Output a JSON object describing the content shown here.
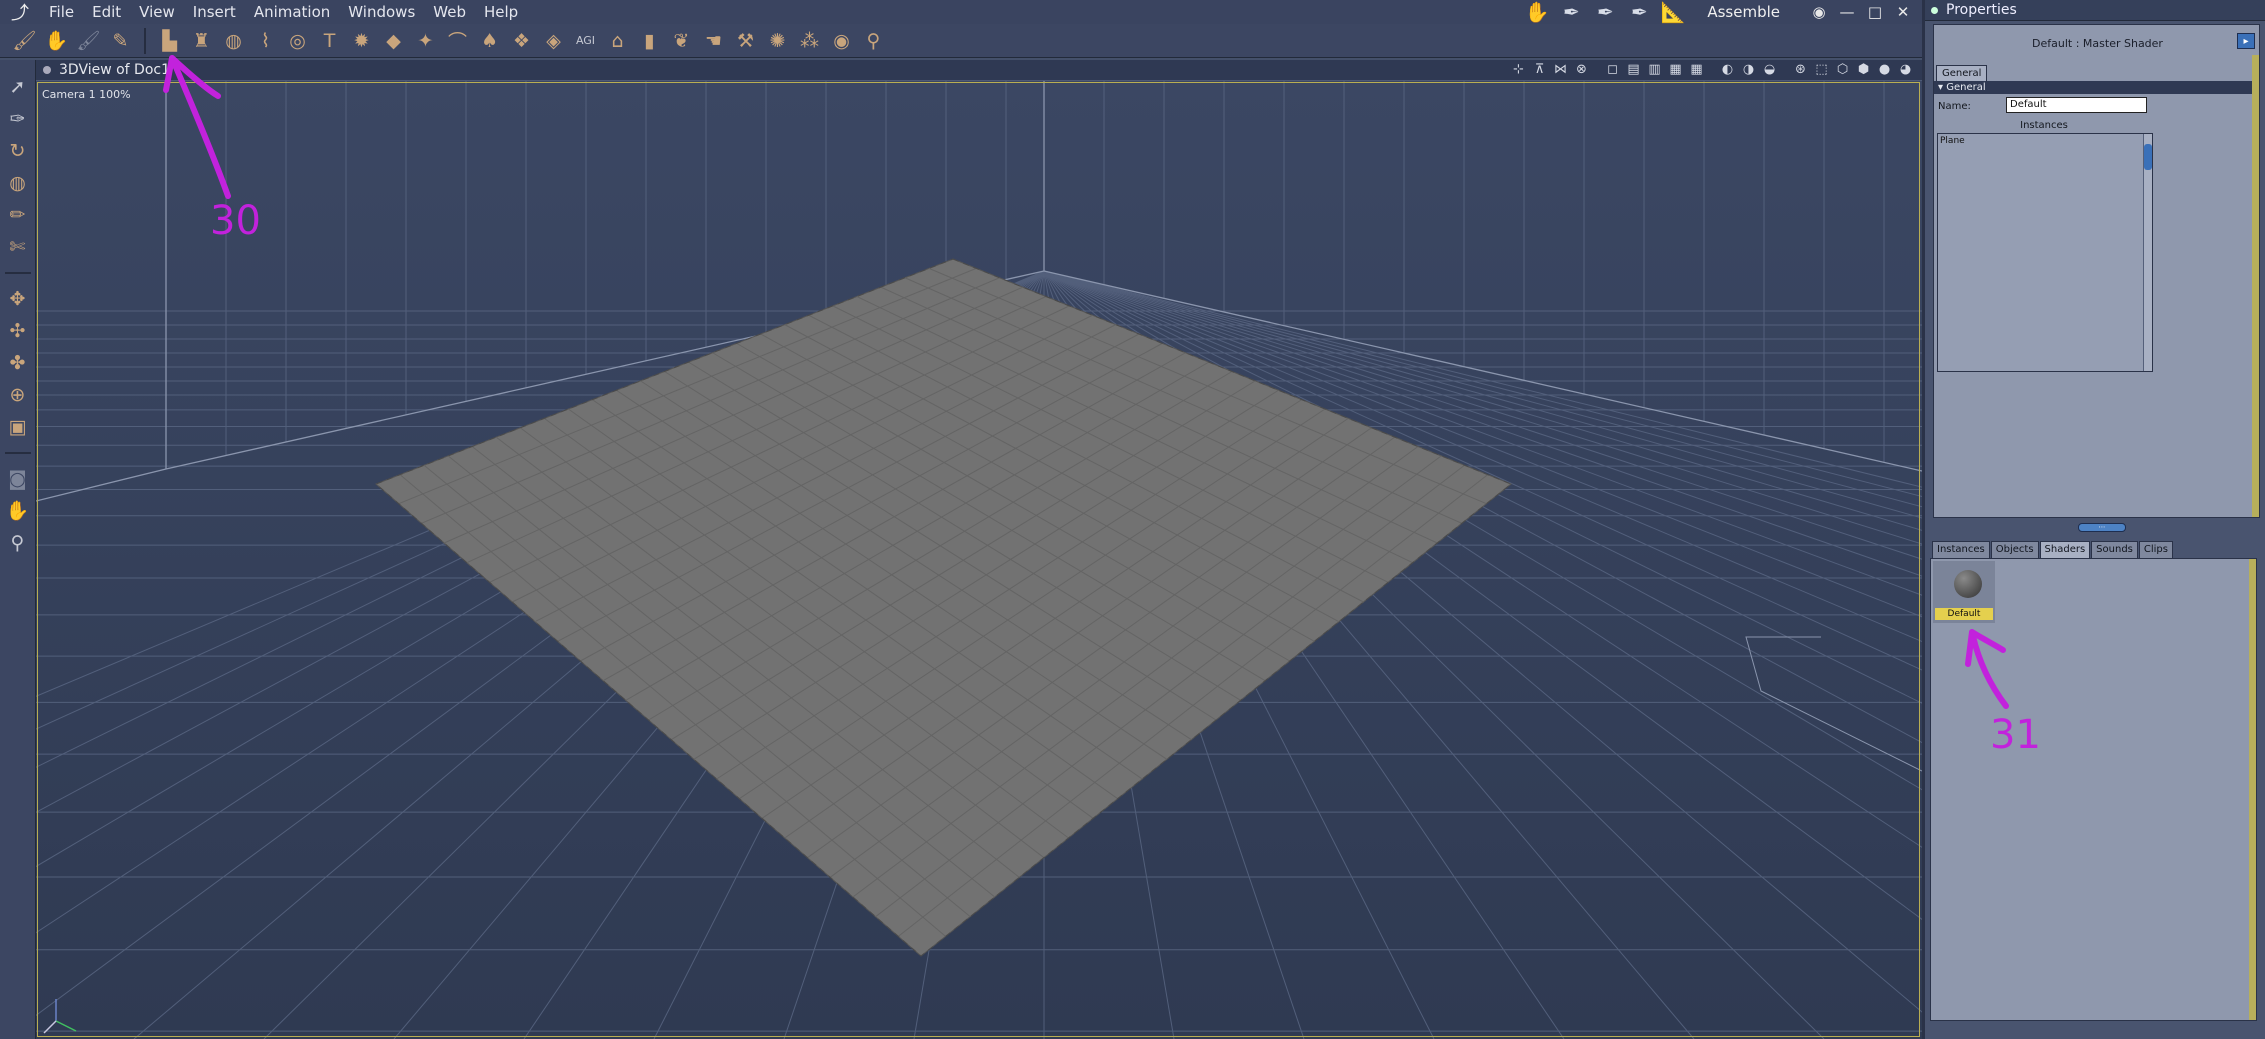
{
  "menubar": {
    "items": [
      "File",
      "Edit",
      "View",
      "Insert",
      "Animation",
      "Windows",
      "Web",
      "Help"
    ],
    "room": "Assemble",
    "room_icons": [
      "hand-icon",
      "pen-icon",
      "pen-icon",
      "pen-icon",
      "ruler-icon"
    ],
    "window_buttons": [
      "◉",
      "—",
      "□",
      "✕"
    ]
  },
  "toolbar": {
    "icons": [
      "paint-brush-icon",
      "hand-icon",
      "brush-icon",
      "sculpt-brush-icon",
      "terrain-icon",
      "lathe-icon",
      "sphere-icon",
      "pipe-icon",
      "torus-icon",
      "text-icon",
      "gear-icon",
      "plane-icon",
      "landscape-icon",
      "boolean-icon",
      "primitive-icon",
      "box-icon",
      "box-icon",
      "agi-icon",
      "house-icon",
      "cylinder-icon",
      "leaf-icon",
      "hand-shape-icon",
      "magic-wand-icon",
      "cog-icon",
      "tree-icon",
      "target-icon",
      "bone-icon"
    ]
  },
  "lefttools": {
    "group1": [
      "select-arrow-icon",
      "pen-tool-icon",
      "rotate-icon",
      "spiral-icon",
      "pencil-icon",
      "knife-icon"
    ],
    "group2": [
      "move-icon",
      "move-alt-icon",
      "scale-icon",
      "rotate-trackball-icon",
      "cube-icon"
    ],
    "group3": [
      "camera-icon",
      "pan-hand-icon",
      "zoom-icon"
    ]
  },
  "viewport": {
    "title": "3DView of Doc1",
    "camera_label": "Camera 1 100%",
    "header_icons": [
      "snap-icon",
      "lock-icon",
      "grid-icon",
      "cross-icon",
      "layout-single-icon",
      "layout-two-icon",
      "layout-three-icon",
      "layout-four-icon",
      "view-mask-icon",
      "view-mask-icon",
      "view-mask-icon",
      "axis-icon",
      "bbox-icon",
      "cube-icon",
      "cube-solid-icon",
      "sphere-shaded-icon",
      "sphere-shaded-icon"
    ],
    "object_name": "Plane"
  },
  "properties": {
    "title": "Properties",
    "shader_title": "Default : Master Shader",
    "tab": "General",
    "group": "General",
    "name_label": "Name:",
    "name_value": "Default",
    "instances_label": "Instances",
    "instances": [
      "Plane"
    ]
  },
  "library": {
    "tabs": [
      "Instances",
      "Objects",
      "Shaders",
      "Sounds",
      "Clips"
    ],
    "active_tab": "Shaders",
    "shaders": [
      {
        "label": "Default"
      }
    ]
  },
  "annotations": {
    "a30": "30",
    "a31": "31"
  },
  "colors": {
    "annotation": "#c222dc",
    "viewport_bg": "#35405a",
    "highlight_yellow": "#e4d04e",
    "accent_blue": "#3a70b8"
  }
}
